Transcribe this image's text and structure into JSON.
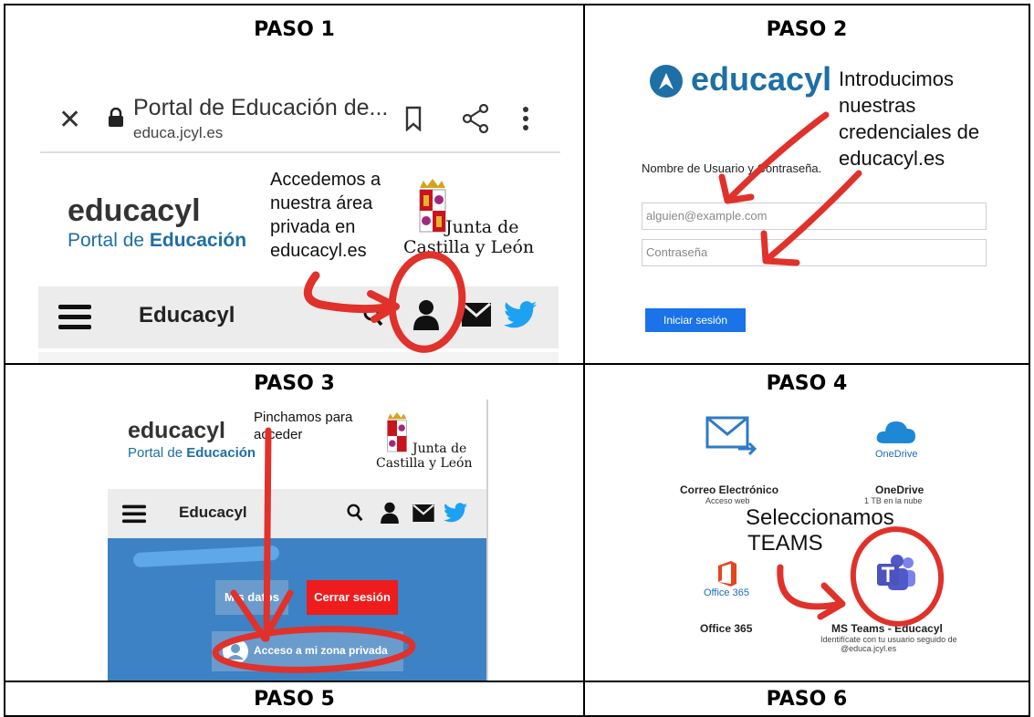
{
  "steps": {
    "s1": "PASO 1",
    "s2": "PASO 2",
    "s3": "PASO 3",
    "s4": "PASO 4",
    "s5": "PASO 5",
    "s6": "PASO 6"
  },
  "paso1": {
    "page_title": "Portal de Educación de...",
    "url": "educa.jcyl.es",
    "brand": "educacyl",
    "portal_prefix": "Portal de ",
    "portal_strong": "Educación",
    "annotation": [
      "Accedemos a",
      "nuestra área",
      "privada en",
      "educacyl.es"
    ],
    "junta_line1": "Junta de",
    "junta_line2": "Castilla y León",
    "nav_title": "Educacyl"
  },
  "paso2": {
    "brand": "educacyl",
    "annotation": [
      "Introducimos",
      "nuestras",
      "credenciales de",
      "educacyl.es"
    ],
    "form_label": "Nombre de Usuario y Contraseña.",
    "username_placeholder": "alguien@example.com",
    "password_placeholder": "Contraseña",
    "login_button": "Iniciar sesión"
  },
  "paso3": {
    "brand": "educacyl",
    "portal_prefix": "Portal de ",
    "portal_strong": "Educación",
    "annotation": [
      "Pinchamos para",
      "acceder"
    ],
    "junta_line1": "Junta de",
    "junta_line2": "Castilla y León",
    "nav_title": "Educacyl",
    "misdatos_label": "Mis datos",
    "logout_button": "Cerrar sesión",
    "private_zone_button": "Acceso a mi zona privada"
  },
  "paso4": {
    "mail_title": "Correo Electrónico",
    "mail_sub": "Acceso web",
    "onedrive_logo_text": "OneDrive",
    "onedrive_title": "OneDrive",
    "onedrive_sub": "1 TB en la nube",
    "annotation": [
      "Seleccionamos",
      "TEAMS"
    ],
    "office_logo_text": "Office 365",
    "office_title": "Office 365",
    "teams_title": "MS Teams - Educacyl",
    "teams_sub_1": "Identifícate con tu usuario seguido de",
    "teams_sub_2": "@educa.jcyl.es"
  },
  "colors": {
    "annotation_red": "#e0312b",
    "educacyl_blue": "#1d6fa5",
    "login_blue": "#1a73e8",
    "logout_red": "#ee1c1c",
    "zone_blue": "#3d82c4",
    "twitter_blue": "#1da1f2"
  }
}
